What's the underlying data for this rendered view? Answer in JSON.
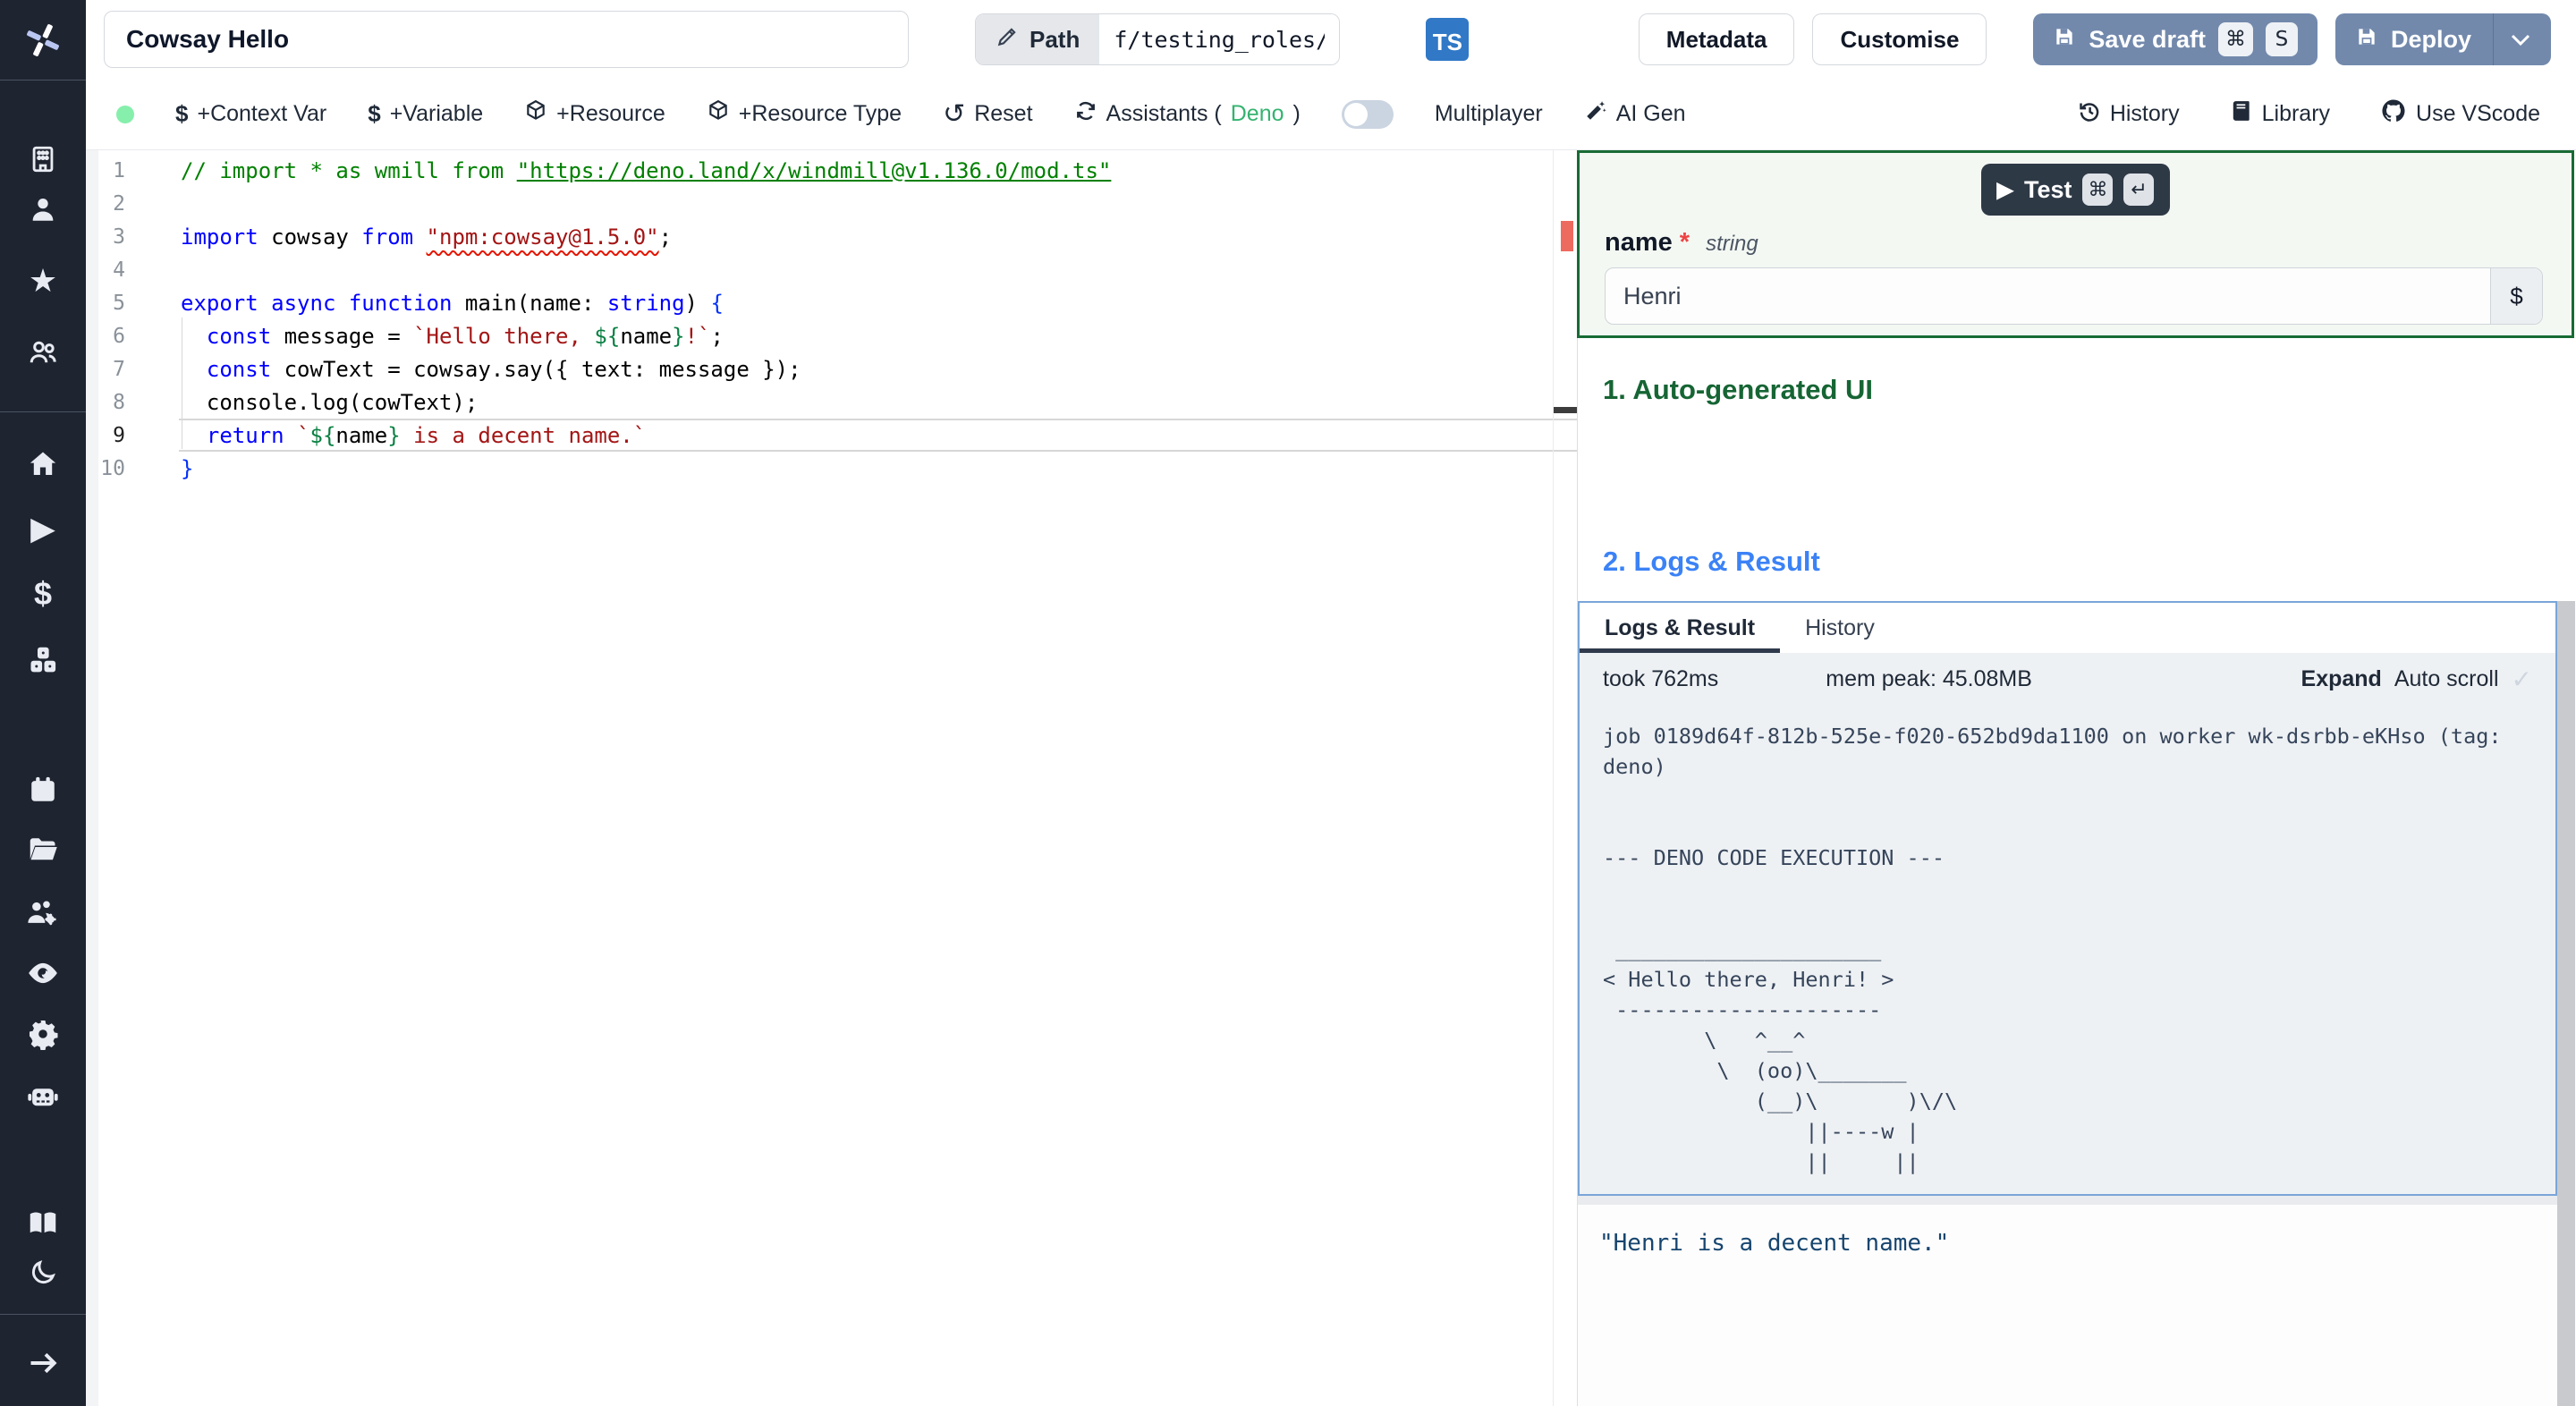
{
  "topbar": {
    "title_value": "Cowsay Hello",
    "path_label": "Path",
    "path_value": "f/testing_roles/cowsa",
    "lang_badge": "TS",
    "metadata_label": "Metadata",
    "customise_label": "Customise",
    "save_draft_label": "Save draft",
    "save_kbd1": "⌘",
    "save_kbd2": "S",
    "deploy_label": "Deploy"
  },
  "toolbar": {
    "context_var": "+Context Var",
    "variable": "+Variable",
    "resource": "+Resource",
    "resource_type": "+Resource Type",
    "reset": "Reset",
    "assistants_prefix": "Assistants (",
    "assistants_lang": "Deno",
    "assistants_suffix": ")",
    "multiplayer": "Multiplayer",
    "ai_gen": "AI Gen",
    "history": "History",
    "library": "Library",
    "vscode": "Use VScode"
  },
  "sidebar": {
    "icons": [
      "windmill-logo",
      "building",
      "person",
      "star",
      "users",
      "home",
      "play",
      "dollar",
      "cubes",
      "calendar",
      "folder",
      "user-settings",
      "eye",
      "gear",
      "robot",
      "book",
      "moon",
      "arrow-right"
    ]
  },
  "editor": {
    "lines": [
      {
        "n": "1",
        "tokens": [
          {
            "c": "comment",
            "t": "// import * as wmill from "
          },
          {
            "c": "comment-link",
            "t": "\"https://deno.land/x/windmill@v1.136.0/mod.ts\""
          }
        ]
      },
      {
        "n": "2",
        "tokens": []
      },
      {
        "n": "3",
        "tokens": [
          {
            "c": "kw",
            "t": "import"
          },
          {
            "c": "plain",
            "t": " cowsay "
          },
          {
            "c": "kw",
            "t": "from"
          },
          {
            "c": "plain",
            "t": " "
          },
          {
            "c": "str squig",
            "t": "\"npm:cowsay@1.5.0\""
          },
          {
            "c": "plain",
            "t": ";"
          }
        ]
      },
      {
        "n": "4",
        "tokens": []
      },
      {
        "n": "5",
        "tokens": [
          {
            "c": "kw",
            "t": "export"
          },
          {
            "c": "plain",
            "t": " "
          },
          {
            "c": "kw",
            "t": "async"
          },
          {
            "c": "plain",
            "t": " "
          },
          {
            "c": "kw",
            "t": "function"
          },
          {
            "c": "plain",
            "t": " main(name: "
          },
          {
            "c": "type",
            "t": "string"
          },
          {
            "c": "plain",
            "t": ") "
          },
          {
            "c": "brace",
            "t": "{"
          }
        ]
      },
      {
        "n": "6",
        "tokens": [
          {
            "c": "plain",
            "t": "  "
          },
          {
            "c": "kw",
            "t": "const"
          },
          {
            "c": "plain",
            "t": " message = "
          },
          {
            "c": "str",
            "t": "`Hello there, "
          },
          {
            "c": "expr",
            "t": "${"
          },
          {
            "c": "plain",
            "t": "name"
          },
          {
            "c": "expr",
            "t": "}"
          },
          {
            "c": "str",
            "t": "!`"
          },
          {
            "c": "plain",
            "t": ";"
          }
        ]
      },
      {
        "n": "7",
        "tokens": [
          {
            "c": "plain",
            "t": "  "
          },
          {
            "c": "kw",
            "t": "const"
          },
          {
            "c": "plain",
            "t": " cowText = cowsay.say({ text: message });"
          }
        ]
      },
      {
        "n": "8",
        "tokens": [
          {
            "c": "plain",
            "t": "  console.log(cowText);"
          }
        ]
      },
      {
        "n": "9",
        "active": true,
        "tokens": [
          {
            "c": "plain",
            "t": "  "
          },
          {
            "c": "kw",
            "t": "return"
          },
          {
            "c": "plain",
            "t": " "
          },
          {
            "c": "str",
            "t": "`"
          },
          {
            "c": "expr",
            "t": "${"
          },
          {
            "c": "plain",
            "t": "name"
          },
          {
            "c": "expr",
            "t": "}"
          },
          {
            "c": "str",
            "t": " is a decent name.`"
          }
        ]
      },
      {
        "n": "10",
        "tokens": [
          {
            "c": "brace",
            "t": "}"
          }
        ]
      }
    ]
  },
  "panel": {
    "test_label": "Test",
    "test_kbd1": "⌘",
    "test_kbd2": "↵",
    "field_name": "name",
    "field_required": "*",
    "field_type": "string",
    "field_value": "Henri",
    "dollar_btn": "$",
    "section1": "1. Auto-generated UI",
    "section2": "2. Logs & Result",
    "tabs": [
      "Logs & Result",
      "History"
    ],
    "took": "took 762ms",
    "mem": "mem peak: 45.08MB",
    "expand": "Expand",
    "autoscroll": "Auto scroll",
    "check_icon": "✓",
    "log_text": "job 0189d64f-812b-525e-f020-652bd9da1100 on worker wk-dsrbb-eKHso (tag:\ndeno)\n\n\n--- DENO CODE EXECUTION ---\n\n\n _____________________\n< Hello there, Henri! >\n ---------------------\n        \\   ^__^\n         \\  (oo)\\_______\n            (__)\\       )\\/\\\n                ||----w |\n                ||     ||",
    "result": "\"Henri is a decent name.\""
  },
  "colors": {
    "sidebar_bg": "#1e2430",
    "primary_button": "#7289ac",
    "ts_badge": "#3178c6",
    "deno_green": "#34b36f",
    "status_dot_green": "#86efac",
    "heading_green": "#166534",
    "heading_blue": "#3b82f6",
    "logs_border": "#7aa5d8",
    "error_marker": "#ed6a5f",
    "test_button_bg": "#2e3946",
    "required_red": "#ef4444"
  }
}
